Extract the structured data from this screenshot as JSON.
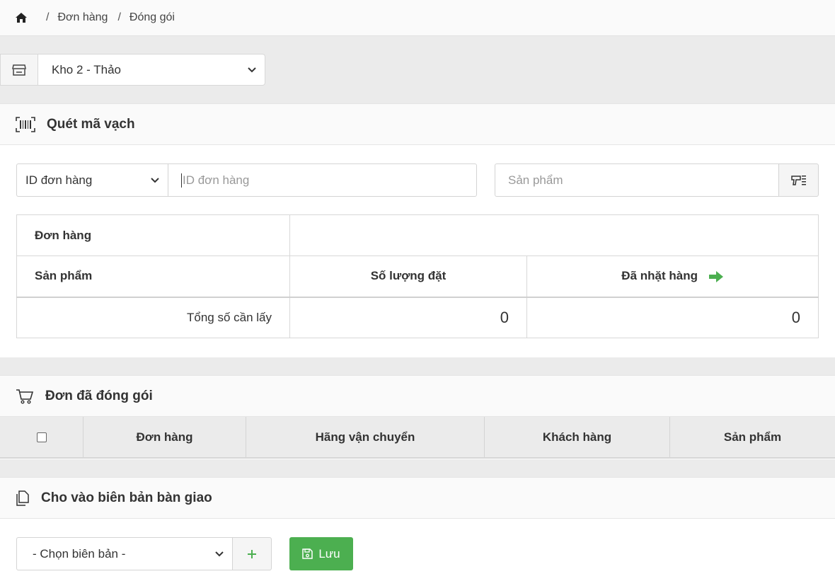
{
  "breadcrumb": {
    "items": [
      "Đơn hàng",
      "Đóng gói"
    ]
  },
  "warehouse": {
    "selected": "Kho 2 - Thảo"
  },
  "scan": {
    "title": "Quét mã vạch",
    "id_type": "ID đơn hàng",
    "id_placeholder": "ID đơn hàng",
    "product_placeholder": "Sản phẩm",
    "table": {
      "order_label": "Đơn hàng",
      "product_label": "Sản phẩm",
      "qty_ordered": "Số lượng đặt",
      "picked": "Đã nhặt hàng",
      "total_label": "Tổng số cần lấy",
      "total_ordered": "0",
      "total_picked": "0"
    }
  },
  "packed": {
    "title": "Đơn đã đóng gói",
    "columns": [
      "Đơn hàng",
      "Hãng vận chuyển",
      "Khách hàng",
      "Sản phẩm"
    ]
  },
  "handover": {
    "title": "Cho vào biên bản bàn giao",
    "select_placeholder": "- Chọn biên bản -",
    "save_label": "Lưu"
  },
  "colors": {
    "accent_green": "#4caf50"
  }
}
